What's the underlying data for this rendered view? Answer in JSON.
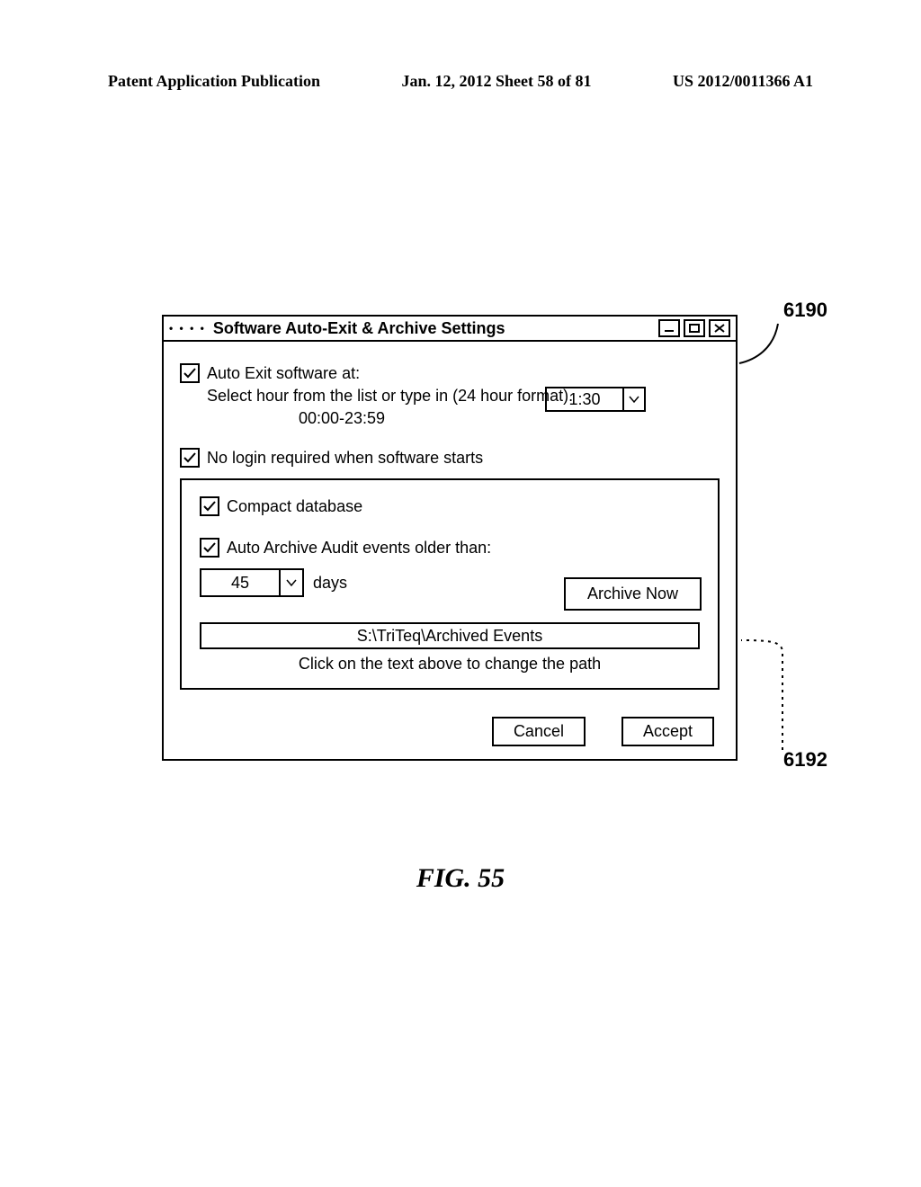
{
  "header": {
    "left": "Patent Application Publication",
    "center": "Jan. 12, 2012  Sheet 58 of 81",
    "right": "US 2012/0011366 A1"
  },
  "refs": {
    "r6190": "6190",
    "r6192": "6192"
  },
  "dialog": {
    "title": "Software Auto-Exit & Archive Settings",
    "auto_exit_label": "Auto Exit software at:",
    "time_value": "1:30",
    "hint1": "Select hour from the list or type in (24 hour format).",
    "hint2": "00:00-23:59",
    "no_login_label": "No login required when software starts",
    "compact_label": "Compact database",
    "auto_archive_label": "Auto Archive Audit events older than:",
    "days_value": "45",
    "days_unit": "days",
    "archive_now": "Archive Now",
    "archive_path": "S:\\TriTeq\\Archived Events",
    "path_hint": "Click on the text above to change the path",
    "cancel": "Cancel",
    "accept": "Accept"
  },
  "caption": "FIG. 55"
}
